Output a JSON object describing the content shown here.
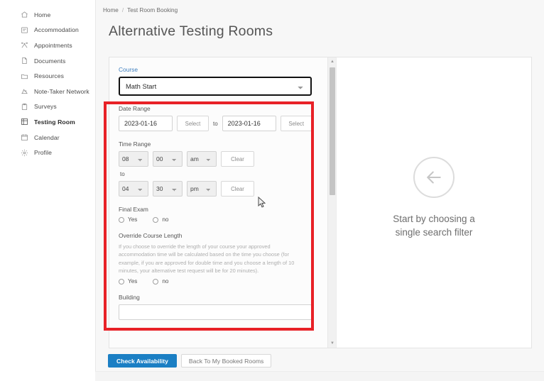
{
  "sidebar": {
    "items": [
      {
        "label": "Home",
        "icon": "home-icon",
        "active": false
      },
      {
        "label": "Accommodation",
        "icon": "note-icon",
        "active": false
      },
      {
        "label": "Appointments",
        "icon": "appointments-icon",
        "active": false
      },
      {
        "label": "Documents",
        "icon": "document-icon",
        "active": false
      },
      {
        "label": "Resources",
        "icon": "folder-icon",
        "active": false
      },
      {
        "label": "Note-Taker Network",
        "icon": "note-taker-icon",
        "active": false
      },
      {
        "label": "Surveys",
        "icon": "clipboard-icon",
        "active": false
      },
      {
        "label": "Testing Room",
        "icon": "grid-icon",
        "active": true
      },
      {
        "label": "Calendar",
        "icon": "calendar-icon",
        "active": false
      },
      {
        "label": "Profile",
        "icon": "gear-icon",
        "active": false
      }
    ]
  },
  "breadcrumb": {
    "home": "Home",
    "separator": "/",
    "current": "Test Room Booking"
  },
  "page": {
    "title": "Alternative Testing Rooms"
  },
  "form": {
    "course": {
      "label": "Course",
      "value": "Math Start",
      "options": [
        "Math Start"
      ]
    },
    "date_range": {
      "label": "Date Range",
      "from_value": "2023-01-16",
      "from_select_label": "Select",
      "to_text": "to",
      "to_value": "2023-01-16",
      "to_select_label": "Select"
    },
    "time_range": {
      "label": "Time Range",
      "to_text": "to",
      "start": {
        "hour": "08",
        "minute": "00",
        "meridiem": "am",
        "clear_label": "Clear",
        "hour_options": [
          "08",
          "04"
        ],
        "minute_options": [
          "00",
          "30"
        ],
        "meridiem_options": [
          "am",
          "pm"
        ]
      },
      "end": {
        "hour": "04",
        "minute": "30",
        "meridiem": "pm",
        "clear_label": "Clear",
        "hour_options": [
          "08",
          "04"
        ],
        "minute_options": [
          "00",
          "30"
        ],
        "meridiem_options": [
          "am",
          "pm"
        ]
      }
    },
    "final_exam": {
      "label": "Final Exam",
      "yes_label": "Yes",
      "no_label": "no",
      "selected": ""
    },
    "override_course_length": {
      "label": "Override Course Length",
      "help": "If you choose to override the length of your course your approved accommodation time will be calculated based on the time you choose (for example, if you are approved for double time and you choose a length of 10 minutes, your alternative test request will be for 20 minutes).",
      "yes_label": "Yes",
      "no_label": "no",
      "selected": ""
    },
    "building": {
      "label": "Building",
      "value": "",
      "placeholder": ""
    }
  },
  "results": {
    "empty_icon": "arrow-left-circle-icon",
    "empty_message_line1": "Start by choosing a",
    "empty_message_line2": "single search filter"
  },
  "actions": {
    "check_availability": "Check Availability",
    "back_to_booked_rooms": "Back To My Booked Rooms"
  },
  "colors": {
    "primary_button": "#1b7fc4",
    "highlight_border": "#e82127",
    "link_blue": "#3e7fbf"
  }
}
